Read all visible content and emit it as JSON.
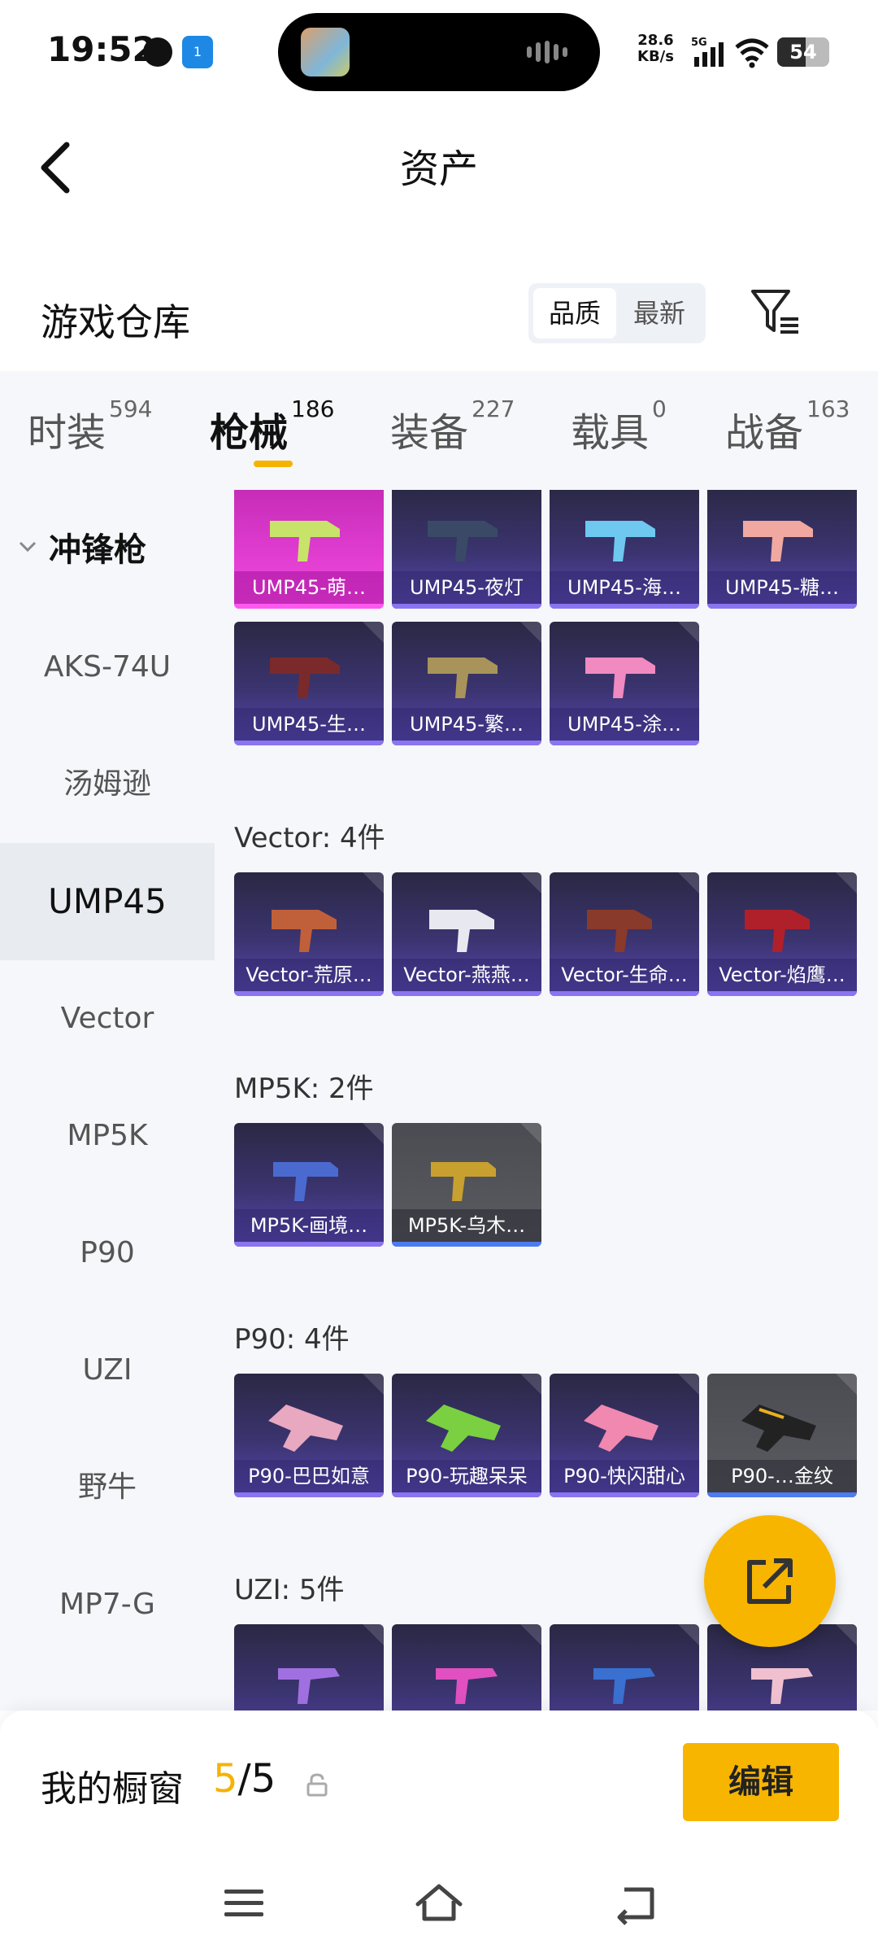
{
  "status_bar": {
    "time": "19:52",
    "nfc_badge": "1",
    "speed_value": "28.6",
    "speed_unit": "KB/s",
    "network": "5G",
    "battery": "54",
    "battery_level": 0.54
  },
  "header": {
    "title": "资产",
    "back_icon": "chevron-left-icon"
  },
  "warehouse": {
    "title": "游戏仓库",
    "sort_options": [
      "品质",
      "最新"
    ],
    "active_sort": "品质",
    "filter_icon": "filter-icon"
  },
  "category_tabs": [
    {
      "label": "时装",
      "count": "594"
    },
    {
      "label": "枪械",
      "count": "186",
      "active": true
    },
    {
      "label": "装备",
      "count": "227"
    },
    {
      "label": "载具",
      "count": "0"
    },
    {
      "label": "战备",
      "count": "163"
    }
  ],
  "sub_categories": {
    "group": "冲锋枪",
    "items": [
      "AKS-74U",
      "汤姆逊",
      "UMP45",
      "Vector",
      "MP5K",
      "P90",
      "UZI",
      "野牛",
      "MP7-G"
    ],
    "selected": "UMP45"
  },
  "sections": {
    "ump45": {
      "cards": [
        "UMP45-萌…",
        "UMP45-夜灯",
        "UMP45-海…",
        "UMP45-糖…",
        "UMP45-生…",
        "UMP45-繁…",
        "UMP45-涂…"
      ]
    },
    "vector": {
      "label": "Vector: 4件",
      "cards": [
        "Vector-荒原…",
        "Vector-燕燕…",
        "Vector-生命…",
        "Vector-焰鹰…"
      ]
    },
    "mp5k": {
      "label": "MP5K: 2件",
      "cards": [
        "MP5K-画境…",
        "MP5K-乌木…"
      ]
    },
    "p90": {
      "label": "P90: 4件",
      "cards": [
        "P90-巴巴如意",
        "P90-玩趣呆呆",
        "P90-快闪甜心",
        "P90-…金纹"
      ]
    },
    "uzi": {
      "label": "UZI: 5件"
    }
  },
  "fab": {
    "icon": "share-external-icon"
  },
  "showcase": {
    "title": "我的橱窗",
    "current": "5",
    "total": "/5",
    "edit_label": "编辑"
  },
  "navbar": {
    "icons": [
      "menu-icon",
      "home-icon",
      "back-icon"
    ]
  },
  "colors": {
    "accent": "#f7b500",
    "card_purple": "#5a48b3",
    "card_pink": "#e23ed2",
    "card_gray": "#5b5b62"
  }
}
